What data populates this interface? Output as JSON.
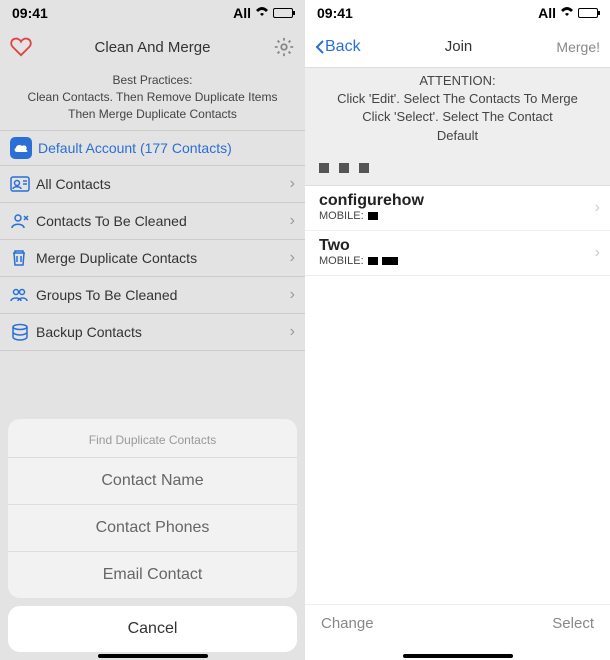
{
  "left": {
    "status": {
      "time": "09:41",
      "carrier": "All"
    },
    "nav": {
      "title": "Clean And Merge"
    },
    "best_practices": {
      "line1": "Best Practices:",
      "line2": "Clean Contacts. Then Remove Duplicate Items",
      "line3": "Then Merge Duplicate Contacts"
    },
    "account": {
      "label": "Default Account (177 Contacts)"
    },
    "menu": {
      "all_contacts": "All Contacts",
      "to_be_cleaned": "Contacts To Be Cleaned",
      "merge_dup": "Merge Duplicate Contacts",
      "groups": "Groups To Be Cleaned",
      "backup": "Backup Contacts"
    },
    "sheet": {
      "title": "Find Duplicate Contacts",
      "name": "Contact Name",
      "phones": "Contact Phones",
      "email": "Email Contact",
      "cancel": "Cancel"
    }
  },
  "right": {
    "status": {
      "time": "09:41",
      "carrier": "All"
    },
    "nav": {
      "back": "Back",
      "title": "Join",
      "merge": "Merge!"
    },
    "attention": {
      "title": "ATTENTION:",
      "line1": "Click 'Edit'. Select The Contacts To Merge",
      "line2": "Click 'Select'. Select The Contact",
      "line3": "Default"
    },
    "contacts": {
      "c1": {
        "name": "configurehow",
        "mobile_label": "MOBILE:"
      },
      "c2": {
        "name": "Two",
        "mobile_label": "MOBILE:"
      }
    },
    "bottom": {
      "change": "Change",
      "select": "Select"
    }
  }
}
